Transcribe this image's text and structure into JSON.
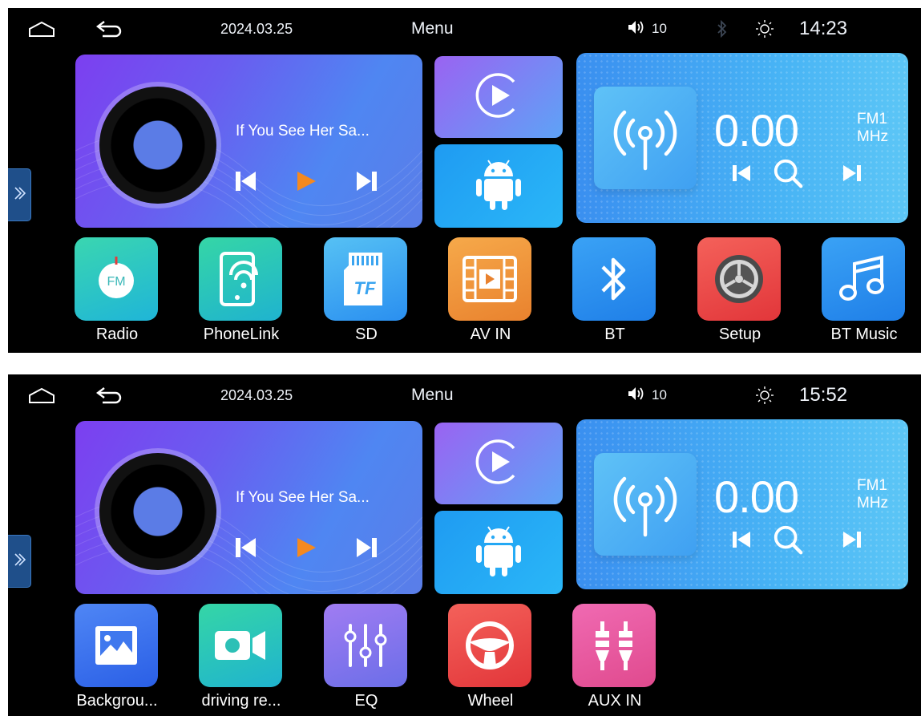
{
  "screens": [
    {
      "statusbar": {
        "date": "2024.03.25",
        "title": "Menu",
        "volume": "10",
        "time": "14:23"
      },
      "music": {
        "song": "If You See Her Sa..."
      },
      "radio": {
        "frequency": "0.00",
        "band": "FM1",
        "unit": "MHz"
      },
      "apps": [
        {
          "label": "Radio",
          "icon": "fm-radio-icon",
          "color": "#29c9b8"
        },
        {
          "label": "PhoneLink",
          "icon": "phonelink-icon",
          "color": "#2ec7b0"
        },
        {
          "label": "SD",
          "icon": "sd-card-icon",
          "color": "#3aa4f0"
        },
        {
          "label": "AV IN",
          "icon": "av-in-icon",
          "color": "#f0923a"
        },
        {
          "label": "BT",
          "icon": "bluetooth-icon",
          "color": "#1f8ef2"
        },
        {
          "label": "Setup",
          "icon": "settings-icon",
          "color": "#ef4a4a"
        },
        {
          "label": "BT Music",
          "icon": "music-note-icon",
          "color": "#1f8ef2"
        }
      ],
      "fm_badge": "FM",
      "sd_badge": "TF"
    },
    {
      "statusbar": {
        "date": "2024.03.25",
        "title": "Menu",
        "volume": "10",
        "time": "15:52"
      },
      "music": {
        "song": "If You See Her Sa..."
      },
      "radio": {
        "frequency": "0.00",
        "band": "FM1",
        "unit": "MHz"
      },
      "apps": [
        {
          "label": "Backgrou...",
          "icon": "background-image-icon",
          "color": "#2f6ff0"
        },
        {
          "label": "driving re...",
          "icon": "driving-recorder-icon",
          "color": "#2cc8a8"
        },
        {
          "label": "EQ",
          "icon": "equalizer-icon",
          "color": "#8a6ef0"
        },
        {
          "label": "Wheel",
          "icon": "steering-wheel-icon",
          "color": "#ef4a4a"
        },
        {
          "label": "AUX IN",
          "icon": "aux-in-icon",
          "color": "#ec5aa6"
        }
      ]
    }
  ]
}
